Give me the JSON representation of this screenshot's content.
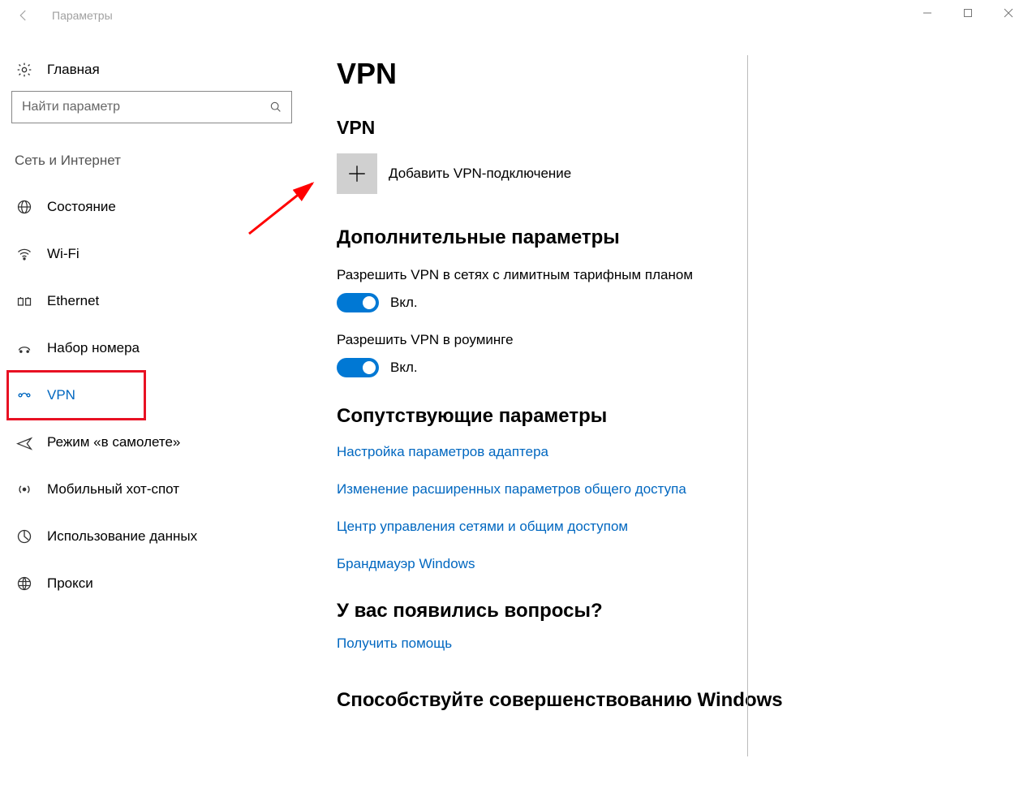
{
  "window": {
    "title": "Параметры"
  },
  "sidebar": {
    "home": "Главная",
    "search_placeholder": "Найти параметр",
    "category": "Сеть и Интернет",
    "items": [
      {
        "label": "Состояние",
        "icon": "globe-icon",
        "active": false
      },
      {
        "label": "Wi-Fi",
        "icon": "wifi-icon",
        "active": false
      },
      {
        "label": "Ethernet",
        "icon": "ethernet-icon",
        "active": false
      },
      {
        "label": "Набор номера",
        "icon": "dialup-icon",
        "active": false
      },
      {
        "label": "VPN",
        "icon": "vpn-icon",
        "active": true
      },
      {
        "label": "Режим «в самолете»",
        "icon": "airplane-icon",
        "active": false
      },
      {
        "label": "Мобильный хот-спот",
        "icon": "hotspot-icon",
        "active": false
      },
      {
        "label": "Использование данных",
        "icon": "data-usage-icon",
        "active": false
      },
      {
        "label": "Прокси",
        "icon": "proxy-icon",
        "active": false
      }
    ]
  },
  "main": {
    "title": "VPN",
    "section1": "VPN",
    "add_vpn": "Добавить VPN-подключение",
    "advanced_heading": "Дополнительные параметры",
    "opt1_label": "Разрешить VPN в сетях с лимитным тарифным планом",
    "opt1_state": "Вкл.",
    "opt2_label": "Разрешить VPN в роуминге",
    "opt2_state": "Вкл.",
    "related_heading": "Сопутствующие параметры",
    "links": [
      "Настройка параметров адаптера",
      "Изменение расширенных параметров общего доступа",
      "Центр управления сетями и общим доступом",
      "Брандмауэр Windows"
    ],
    "questions_heading": "У вас появились вопросы?",
    "get_help": "Получить помощь",
    "feedback_heading": "Способствуйте совершенствованию Windows"
  },
  "annotation": {
    "highlight_target": "sidebar-item-vpn",
    "arrow_target": "add-vpn-button"
  }
}
